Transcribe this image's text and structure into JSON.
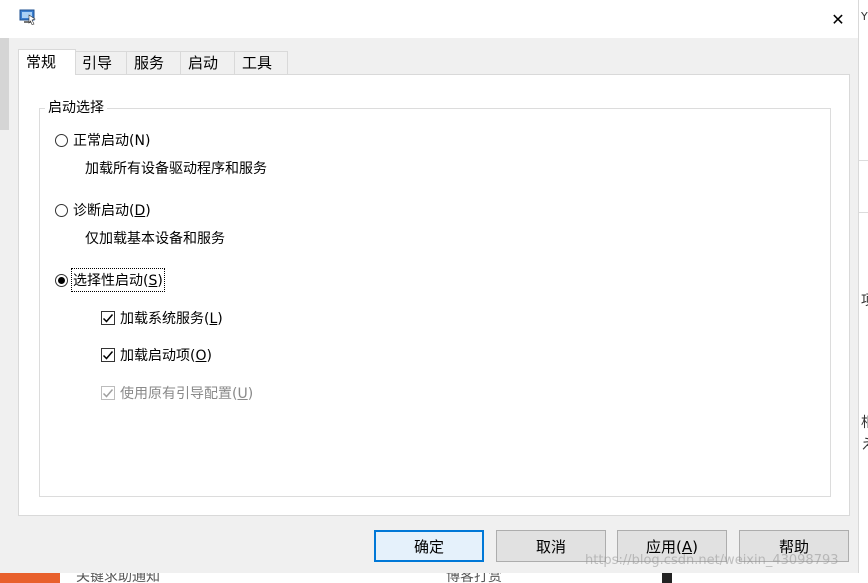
{
  "window": {
    "close_glyph": "✕"
  },
  "tabs": [
    {
      "label": "常规"
    },
    {
      "label": "引导"
    },
    {
      "label": "服务"
    },
    {
      "label": "启动"
    },
    {
      "label": "工具"
    }
  ],
  "startup": {
    "group_label": "启动选择",
    "normal": {
      "label": "正常启动(",
      "key": "N",
      "tail": ")",
      "desc": "加载所有设备驱动程序和服务"
    },
    "diagnostic": {
      "label": "诊断启动(",
      "key": "D",
      "tail": ")",
      "desc": "仅加载基本设备和服务"
    },
    "selective": {
      "label": "选择性启动(",
      "key": "S",
      "tail": ")"
    },
    "options": [
      {
        "label": "加载系统服务(",
        "key": "L",
        "tail": ")"
      },
      {
        "label": "加载启动项(",
        "key": "O",
        "tail": ")"
      },
      {
        "label": "使用原有引导配置(",
        "key": "U",
        "tail": ")"
      }
    ]
  },
  "buttons": {
    "ok": "确定",
    "cancel": "取消",
    "apply": {
      "label": "应用(",
      "key": "A",
      "tail": ")"
    },
    "help": "帮助"
  },
  "background": {
    "right_fragments": [
      "YU",
      "项",
      "相",
      "え"
    ],
    "bottom_fragments": [
      "关键求助通知",
      "博客打赏"
    ]
  },
  "watermark": "https://blog.csdn.net/weixin_43098793",
  "colors": {
    "accent": "#0078d7",
    "window_bg": "#f0f0f0",
    "panel_bg": "#ffffff"
  }
}
